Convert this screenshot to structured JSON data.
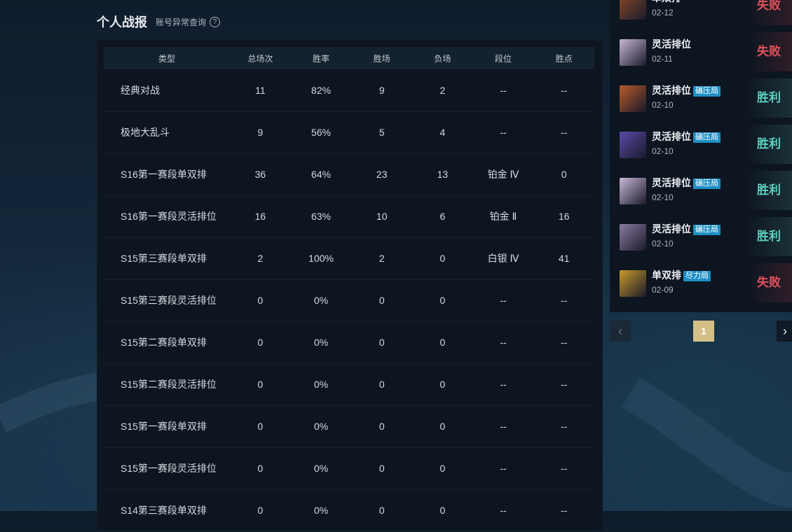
{
  "header": {
    "title": "个人战报",
    "subtitle": "账号异常查询",
    "help_glyph": "?"
  },
  "table": {
    "columns": [
      "类型",
      "总场次",
      "胜率",
      "胜场",
      "负场",
      "段位",
      "胜点"
    ],
    "rows": [
      [
        "经典对战",
        "11",
        "82%",
        "9",
        "2",
        "--",
        "--"
      ],
      [
        "极地大乱斗",
        "9",
        "56%",
        "5",
        "4",
        "--",
        "--"
      ],
      [
        "S16第一赛段单双排",
        "36",
        "64%",
        "23",
        "13",
        "铂金 Ⅳ",
        "0"
      ],
      [
        "S16第一赛段灵活排位",
        "16",
        "63%",
        "10",
        "6",
        "铂金 Ⅱ",
        "16"
      ],
      [
        "S15第三赛段单双排",
        "2",
        "100%",
        "2",
        "0",
        "白银 Ⅳ",
        "41"
      ],
      [
        "S15第三赛段灵活排位",
        "0",
        "0%",
        "0",
        "0",
        "--",
        "--"
      ],
      [
        "S15第二赛段单双排",
        "0",
        "0%",
        "0",
        "0",
        "--",
        "--"
      ],
      [
        "S15第二赛段灵活排位",
        "0",
        "0%",
        "0",
        "0",
        "--",
        "--"
      ],
      [
        "S15第一赛段单双排",
        "0",
        "0%",
        "0",
        "0",
        "--",
        "--"
      ],
      [
        "S15第一赛段灵活排位",
        "0",
        "0%",
        "0",
        "0",
        "--",
        "--"
      ],
      [
        "S14第三赛段单双排",
        "0",
        "0%",
        "0",
        "0",
        "--",
        "--"
      ]
    ]
  },
  "matches": [
    {
      "mode": "单双排",
      "tag": "",
      "date": "02-12",
      "result": "失败",
      "win": false,
      "avatar_color": "#8a4a2a"
    },
    {
      "mode": "灵活排位",
      "tag": "",
      "date": "02-11",
      "result": "失败",
      "win": false,
      "avatar_color": "#c8b8d8"
    },
    {
      "mode": "灵活排位",
      "tag": "碾压局",
      "date": "02-10",
      "result": "胜利",
      "win": true,
      "avatar_color": "#b85a2a"
    },
    {
      "mode": "灵活排位",
      "tag": "碾压局",
      "date": "02-10",
      "result": "胜利",
      "win": true,
      "avatar_color": "#5a4aa8"
    },
    {
      "mode": "灵活排位",
      "tag": "碾压局",
      "date": "02-10",
      "result": "胜利",
      "win": true,
      "avatar_color": "#c8b8d8"
    },
    {
      "mode": "灵活排位",
      "tag": "碾压局",
      "date": "02-10",
      "result": "胜利",
      "win": true,
      "avatar_color": "#8a7aa0"
    },
    {
      "mode": "单双排",
      "tag": "尽力局",
      "date": "02-09",
      "result": "失败",
      "win": false,
      "avatar_color": "#c89a2a"
    }
  ],
  "pagination": {
    "prev": "‹",
    "current": "1",
    "next": "›"
  },
  "colors": {
    "win": "#5fd0c0",
    "lose": "#e0505a",
    "tag_bg": "#1e8fc4",
    "page_active": "#d4c087"
  }
}
